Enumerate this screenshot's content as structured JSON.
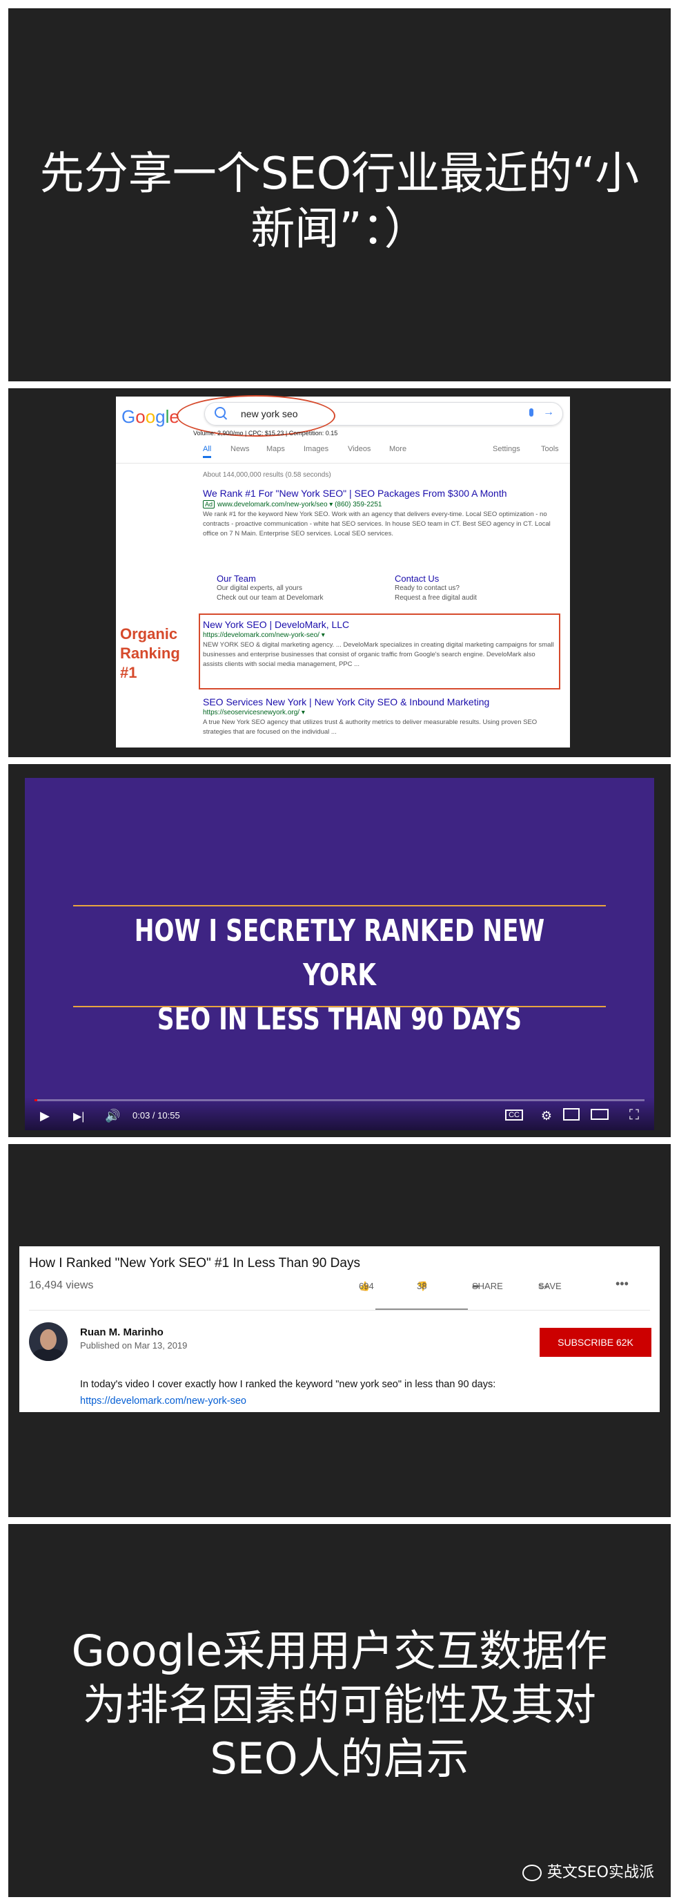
{
  "panel1": {
    "headline": "先分享一个SEO行业最近的“小新闻”：）"
  },
  "serp": {
    "logo": [
      "G",
      "o",
      "o",
      "g",
      "l",
      "e"
    ],
    "logo_colors": [
      "#4285f4",
      "#ea4335",
      "#fbbc05",
      "#4285f4",
      "#34a853",
      "#ea4335"
    ],
    "query": "new york seo",
    "metrics": "Volume: 2,900/mo | CPC: $15.23 | Competition: 0.15",
    "tabs": [
      "All",
      "News",
      "Maps",
      "Images",
      "Videos",
      "More",
      "Settings",
      "Tools"
    ],
    "stats": "About 144,000,000 results (0.58 seconds)",
    "ad": {
      "title": "We Rank #1 For \"New York SEO\" | SEO Packages From $300 A Month",
      "badge": "Ad",
      "url": "www.develomark.com/new-york/seo ▾  (860) 359-2251",
      "desc": "We rank #1 for the keyword New York SEO. Work with an agency that delivers every-time. Local SEO optimization - no contracts - proactive communication - white hat SEO services. In house SEO team in CT. Best SEO agency in CT. Local office on 7 N Main. Enterprise SEO services. Local SEO services."
    },
    "sitelinks": [
      {
        "title": "Our Team",
        "line1": "Our digital experts, all yours",
        "line2": "Check out our team at Develomark"
      },
      {
        "title": "Contact Us",
        "line1": "Ready to contact us?",
        "line2": "Request a free digital audit"
      }
    ],
    "organic_label": "Organic Ranking #1",
    "organic": {
      "title": "New York SEO | DeveloMark, LLC",
      "url": "https://develomark.com/new-york-seo/ ▾",
      "desc": "NEW YORK SEO & digital marketing agency. ... DeveloMark specializes in creating digital marketing campaigns for small businesses and enterprise businesses that consist of organic traffic from Google's search engine. DeveloMark also assists clients with social media management, PPC ..."
    },
    "third": {
      "title": "SEO Services New York | New York City SEO & Inbound Marketing",
      "url": "https://seoservicesnewyork.org/ ▾",
      "desc": "A true New York SEO agency that utilizes trust & authority metrics to deliver measurable results. Using proven SEO strategies that are focused on the individual ..."
    }
  },
  "video": {
    "line1": "HOW I SECRETLY RANKED NEW YORK",
    "line2": "SEO IN LESS THAN 90 DAYS",
    "time": "0:03 / 10:55",
    "progress": 0.005,
    "icons": [
      "play-icon",
      "next-icon",
      "volume-icon",
      "captions-icon",
      "settings-icon",
      "miniplayer-icon",
      "theater-icon",
      "fullscreen-icon"
    ]
  },
  "youtube": {
    "title": "How I Ranked \"New York SEO\" #1 In Less Than 90 Days",
    "views": "16,494 views",
    "likes": "694",
    "dislikes": "38",
    "share": "SHARE",
    "save": "SAVE",
    "author": "Ruan M. Marinho",
    "published": "Published on Mar 13, 2019",
    "subscribe": "SUBSCRIBE  62K",
    "description": "In today's video I cover exactly how I ranked the keyword \"new york seo\" in less than 90 days:",
    "link": "https://develomark.com/new-york-seo"
  },
  "panel5": {
    "line1": "Google采用用户交互数据作",
    "line2": "为排名因素的可能性及其对",
    "line3": "SEO人的启示",
    "brand": "英文SEO实战派"
  }
}
